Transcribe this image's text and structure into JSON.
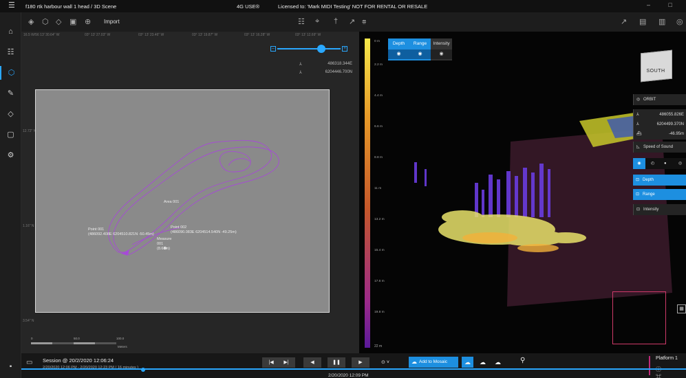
{
  "titlebar": {
    "app_title": "f180 rtk harbour wall 1 head  / 3D Scene",
    "network": "4G USE®",
    "license": "Licensed to: 'Mark MIDI Testing' NOT FOR RENTAL OR RESALE",
    "window_controls": "–  □"
  },
  "sidebar": {
    "items": [
      {
        "name": "home-icon",
        "glyph": "⌂"
      },
      {
        "name": "layout-icon",
        "glyph": "☷"
      },
      {
        "name": "cube-3d-icon",
        "glyph": "⬡"
      },
      {
        "name": "measure-icon",
        "glyph": "✎"
      },
      {
        "name": "eraser-icon",
        "glyph": "◇"
      },
      {
        "name": "box-icon",
        "glyph": "▢"
      },
      {
        "name": "settings-icon",
        "glyph": "⚙"
      }
    ],
    "bottom_glyph": "▪"
  },
  "toolbar": {
    "import_label": "Import",
    "left_glyphs": [
      "◈",
      "⬡",
      "◇",
      "▣",
      "⊕"
    ],
    "mid_glyphs": [
      "☷",
      "⌖",
      "†",
      "↗",
      "⩷"
    ],
    "right_glyphs": [
      "↗",
      "▤",
      "▥",
      "◎"
    ]
  },
  "map2d": {
    "top_coords": [
      "16.5 W/56 13' 30.64\" W",
      "03° 13' 27.03\" W",
      "03° 13' 23.46\" W",
      "03° 13' 19.87\" W",
      "03° 13' 16.28\" W",
      "03° 13' 12.69\" W"
    ],
    "side_coords": [
      "12.72\" N",
      "1.16\" N",
      "3.54\" N"
    ],
    "position": {
      "easting": "486318.344E",
      "northing": "6204446.700N"
    },
    "labels": {
      "area": "Area 001",
      "point1_name": "Point 001",
      "point1_coords": "(486092.408E 6204510.821N -50.45m)",
      "point2_name": "Point 002",
      "point2_coords": "(486090.083E 6204514.540N -49.25m)",
      "measure_name": "Measure",
      "measure_id": "001",
      "measure_len": "(8.68m)"
    },
    "scale": {
      "zero": "0",
      "mid": "50.0",
      "end": "100.0",
      "unit": "Meters"
    }
  },
  "view3d": {
    "depth_ticks": [
      "0 m",
      "2.2 m",
      "4.4 m",
      "6.6 m",
      "8.8 m",
      "11 m",
      "13.2 m",
      "15.4 m",
      "17.6 m",
      "19.8 m"
    ],
    "depth_bottom": "22 m",
    "tabs": [
      {
        "label": "Depth",
        "state": "on"
      },
      {
        "label": "Range",
        "state": "on"
      },
      {
        "label": "Intensity",
        "state": "off"
      }
    ],
    "eye_glyph": "◉",
    "cube_face": "SOUTH",
    "orbit_label": "ORBIT",
    "right_position": {
      "easting": "486055.826E",
      "northing": "6204499.370N",
      "depth": "-46.95m"
    },
    "speed_of_sound": "Speed of Sound",
    "mode_glyphs": [
      "◉",
      "◴",
      "●",
      "◎"
    ],
    "layers": [
      {
        "label": "Depth",
        "style": "blue"
      },
      {
        "label": "Range",
        "style": "blue"
      },
      {
        "label": "Intensity",
        "style": "dark"
      }
    ],
    "corner_glyph": "▦"
  },
  "bottom": {
    "session_title": "Session @ 20/2/2020 12:06:24",
    "session_range": "2/20/2020 12:06 PM - 2/20/2020 12:23 PM ( 16 minutes )",
    "buttons": {
      "first": "|◀",
      "last": "▶|",
      "prev": "◀",
      "pause": "❚❚",
      "next": "▶",
      "speed": "⊙ ˅"
    },
    "current_time": "2/20/2020 12:09 PM",
    "mosaic_label": "Add to Mosaic",
    "cloud_glyphs": [
      "☁",
      "☁",
      "☁"
    ],
    "pin_glyph": "⚲",
    "platform_label": "Platform 1",
    "platform_glyphs": "ⓘ ⌘"
  },
  "colors": {
    "accent": "#1d8fe0",
    "panel": "#1b1b1b",
    "track": "#a64bd6",
    "highlight": "#d03a6a"
  }
}
